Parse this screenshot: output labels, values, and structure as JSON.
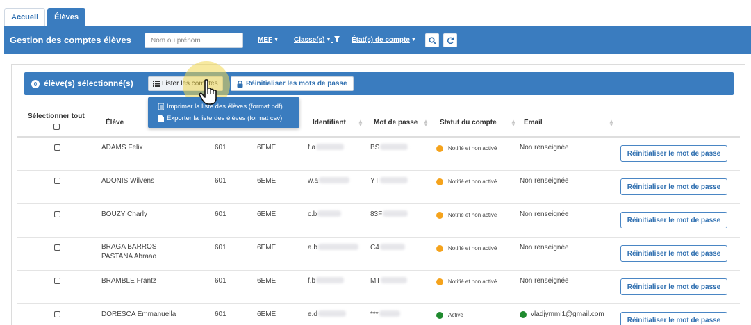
{
  "tabs": [
    {
      "label": "Accueil",
      "active": false
    },
    {
      "label": "Élèves",
      "active": true
    }
  ],
  "header": {
    "title": "Gestion des comptes élèves",
    "search_placeholder": "Nom ou prénom",
    "filter_mef": "MEF",
    "filter_classes": "Classe(s)",
    "filter_etats": "État(s) de compte",
    "search_icon": "search-icon",
    "refresh_icon": "refresh-icon"
  },
  "selection": {
    "count": "0",
    "label": "élève(s) sélectionné(s)",
    "lister_label": "Lister les comptes",
    "reinit_all_label": "Réinitialiser les mots de passe"
  },
  "dropdown": {
    "items": [
      "Imprimer la liste des élèves (format pdf)",
      "Exporter la liste des élèves (format csv)"
    ]
  },
  "table": {
    "headers": {
      "select_all": "Sélectionner tout",
      "eleve": "Élève",
      "identifiant": "Identifiant",
      "mot_de_passe": "Mot de passe",
      "statut": "Statut du compte",
      "email": "Email"
    },
    "rows": [
      {
        "name1": "ADAMS Felix",
        "name2": "",
        "classe": "601",
        "mef": "6EME",
        "ident": "f.a",
        "pwd": "BS",
        "statut": "Notifié et non activé",
        "email": "Non renseignée",
        "action": "Réinitialiser le mot de passe"
      },
      {
        "name1": "ADONIS Wilvens",
        "name2": "",
        "classe": "601",
        "mef": "6EME",
        "ident": "w.a",
        "pwd": "YT",
        "statut": "Notifié et non activé",
        "email": "Non renseignée",
        "action": "Réinitialiser le mot de passe"
      },
      {
        "name1": "BOUZY Charly",
        "name2": "",
        "classe": "601",
        "mef": "6EME",
        "ident": "c.b",
        "pwd": "83F",
        "statut": "Notifié et non activé",
        "email": "Non renseignée",
        "action": "Réinitialiser le mot de passe"
      },
      {
        "name1": "BRAGA BARROS",
        "name2": "PASTANA Abraao",
        "classe": "601",
        "mef": "6EME",
        "ident": "a.b",
        "pwd": "C4",
        "statut": "Notifié et non activé",
        "email": "Non renseignée",
        "action": "Réinitialiser le mot de passe"
      },
      {
        "name1": "BRAMBLE Frantz",
        "name2": "",
        "classe": "601",
        "mef": "6EME",
        "ident": "f.b",
        "pwd": "MT",
        "statut": "Notifié et non activé",
        "email": "Non renseignée",
        "action": "Réinitialiser le mot de passe"
      },
      {
        "name1": "DORESCA Emmanuella",
        "name2": "",
        "classe": "601",
        "mef": "6EME",
        "ident": "e.d",
        "pwd": "***",
        "statut": "Activé",
        "email": "vladjymmi1@gmail.com",
        "action": "Réinitialiser le mot de passe"
      }
    ]
  },
  "colors": {
    "primary": "#3a7cbf",
    "status_pending": "#f5a31c",
    "status_active": "#1f8a2e"
  }
}
